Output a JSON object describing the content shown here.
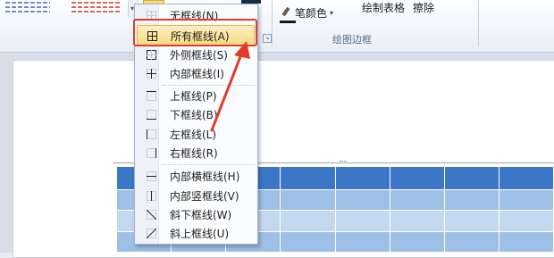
{
  "ribbon": {
    "pen_color_label": "笔颜色",
    "draw_table_label": "绘制表格",
    "eraser_label": "擦除",
    "group_label": "绘图边框",
    "accent_color": "#f9d882"
  },
  "menu": {
    "items": [
      {
        "label": "无框线(N)",
        "icon": "no-border-icon"
      },
      {
        "label": "所有框线(A)",
        "icon": "all-borders-icon",
        "highlighted": true
      },
      {
        "label": "外侧框线(S)",
        "icon": "outside-borders-icon"
      },
      {
        "label": "内部框线(I)",
        "icon": "inside-borders-icon"
      },
      {
        "label": "上框线(P)",
        "icon": "top-border-icon"
      },
      {
        "label": "下框线(B)",
        "icon": "bottom-border-icon"
      },
      {
        "label": "左框线(L)",
        "icon": "left-border-icon"
      },
      {
        "label": "右框线(R)",
        "icon": "right-border-icon"
      },
      {
        "label": "内部横框线(H)",
        "icon": "inside-horizontal-border-icon"
      },
      {
        "label": "内部竖框线(V)",
        "icon": "inside-vertical-border-icon"
      },
      {
        "label": "斜下框线(W)",
        "icon": "diagonal-down-border-icon"
      },
      {
        "label": "斜上框线(U)",
        "icon": "diagonal-up-border-icon"
      }
    ]
  },
  "annotation": {
    "box_color": "#e23b2e",
    "arrow_color": "#e23b2e"
  }
}
